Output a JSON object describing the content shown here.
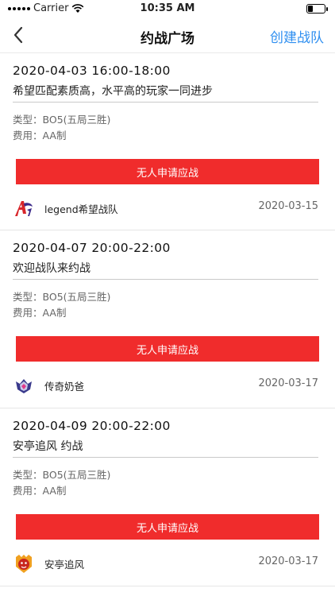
{
  "status_bar": {
    "carrier": "Carrier",
    "time": "10:35 AM"
  },
  "nav": {
    "title": "约战广场",
    "action_label": "创建战队"
  },
  "matches": [
    {
      "time": "2020-04-03 16:00-18:00",
      "description": "希望匹配素质高，水平高的玩家一同进步",
      "type": "类型：BO5(五局三胜)",
      "fee": "费用：AA制",
      "apply_label": "无人申请应战",
      "team_name": "legend希望战队",
      "team_logo_icon": "legend-team-logo-icon",
      "date": "2020-03-15"
    },
    {
      "time": "2020-04-07 20:00-22:00",
      "description": "欢迎战队来约战",
      "type": "类型：BO5(五局三胜)",
      "fee": "费用：AA制",
      "apply_label": "无人申请应战",
      "team_name": "传奇奶爸",
      "team_logo_icon": "shield-team-logo-icon",
      "date": "2020-03-17"
    },
    {
      "time": "2020-04-09 20:00-22:00",
      "description": "安亭追风 约战",
      "type": "类型：BO5(五局三胜)",
      "fee": "费用：AA制",
      "apply_label": "无人申请应战",
      "team_name": "安亭追风",
      "team_logo_icon": "tiger-team-logo-icon",
      "date": "2020-03-17"
    }
  ],
  "colors": {
    "accent_blue": "#2f8ff0",
    "button_red": "#f02c2c"
  }
}
